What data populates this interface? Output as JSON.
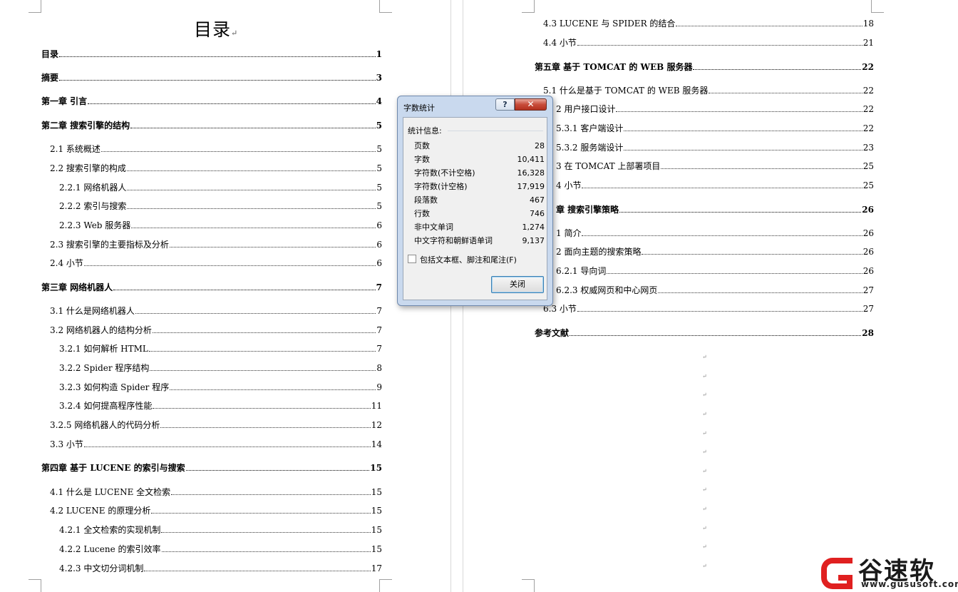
{
  "left_page": {
    "title": "目录",
    "title_mark": "↵",
    "entries": [
      {
        "text": "目录",
        "page": "1"
      },
      {
        "text": "摘要",
        "page": "3"
      },
      {
        "text": "第一章  引言",
        "page": "4"
      },
      {
        "text": "第二章  搜索引擎的结构",
        "page": "5"
      },
      {
        "text": "2.1 系统概述",
        "page": "5"
      },
      {
        "text": "2.2 搜索引擎的构成",
        "page": "5"
      },
      {
        "text": "2.2.1 网络机器人",
        "page": "5"
      },
      {
        "text": "2.2.2 索引与搜索",
        "page": "5"
      },
      {
        "text": "2.2.3 Web 服务器",
        "page": "6"
      },
      {
        "text": "2.3 搜索引擎的主要指标及分析",
        "page": "6"
      },
      {
        "text": "2.4 小节",
        "page": "6"
      },
      {
        "text": "第三章  网络机器人",
        "page": "7"
      },
      {
        "text": "3.1 什么是网络机器人",
        "page": "7"
      },
      {
        "text": "3.2 网络机器人的结构分析",
        "page": "7"
      },
      {
        "text": "3.2.1 如何解析 HTML",
        "page": "7"
      },
      {
        "text": "3.2.2 Spider 程序结构",
        "page": "8"
      },
      {
        "text": "3.2.3 如何构造 Spider 程序",
        "page": "9"
      },
      {
        "text": "3.2.4 如何提高程序性能",
        "page": "11"
      },
      {
        "text": "3.2.5 网络机器人的代码分析",
        "page": "12"
      },
      {
        "text": "3.3 小节",
        "page": "14"
      },
      {
        "text": "第四章  基于 LUCENE 的索引与搜索",
        "page": "15"
      },
      {
        "text": "4.1 什么是 LUCENE 全文检索",
        "page": "15"
      },
      {
        "text": "4.2 LUCENE 的原理分析",
        "page": "15"
      },
      {
        "text": "4.2.1 全文检索的实现机制",
        "page": "15"
      },
      {
        "text": "4.2.2  Lucene 的索引效率",
        "page": "15"
      },
      {
        "text": "4.2.3  中文切分词机制",
        "page": "17"
      }
    ]
  },
  "right_page": {
    "entries": [
      {
        "text": "4.3 LUCENE 与 SPIDER 的结合",
        "page": "18"
      },
      {
        "text": "4.4 小节",
        "page": "21"
      },
      {
        "text": "第五章  基于 TOMCAT 的 WEB 服务器",
        "page": "22"
      },
      {
        "text": "5.1 什么是基于 TOMCAT 的 WEB 服务器",
        "page": "22"
      },
      {
        "text": "2 用户接口设计",
        "page": "22"
      },
      {
        "text": "5.3.1 客户端设计",
        "page": "22"
      },
      {
        "text": "5.3.2 服务端设计",
        "page": "23"
      },
      {
        "text": "3 在 TOMCAT 上部署项目",
        "page": "25"
      },
      {
        "text": "4 小节",
        "page": "25"
      },
      {
        "text": "章  搜索引擎策略",
        "page": "26"
      },
      {
        "text": "1 简介",
        "page": "26"
      },
      {
        "text": "2 面向主题的搜索策略",
        "page": "26"
      },
      {
        "text": "6.2.1 导向词",
        "page": "26"
      },
      {
        "text": "6.2.3 权威网页和中心网页",
        "page": "27"
      },
      {
        "text": "6.3 小节",
        "page": "27"
      },
      {
        "text": "参考文献",
        "page": "28"
      }
    ],
    "paragraph_mark": "↵"
  },
  "dialog": {
    "title": "字数统计",
    "help_label": "?",
    "close_icon": "✕",
    "group_label": "统计信息:",
    "stats": [
      {
        "label": "页数",
        "value": "28"
      },
      {
        "label": "字数",
        "value": "10,411"
      },
      {
        "label": "字符数(不计空格)",
        "value": "16,328"
      },
      {
        "label": "字符数(计空格)",
        "value": "17,919"
      },
      {
        "label": "段落数",
        "value": "467"
      },
      {
        "label": "行数",
        "value": "746"
      },
      {
        "label": "非中文单词",
        "value": "1,274"
      },
      {
        "label": "中文字符和朝鲜语单词",
        "value": "9,137"
      }
    ],
    "checkbox_label": "包括文本框、脚注和尾注(F)",
    "checkbox_checked": false,
    "close_button": "关闭"
  },
  "watermark": {
    "name": "谷速软件",
    "url": "www.gususoft.com",
    "brand_color": "#e02020"
  }
}
